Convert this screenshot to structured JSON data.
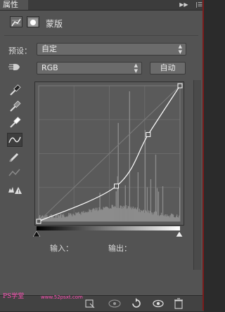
{
  "panel": {
    "tab_title": "属性",
    "header_label": "蒙版",
    "icons": [
      "curves-adjust-icon",
      "mask-icon"
    ]
  },
  "preset": {
    "label": "预设：",
    "value": "自定"
  },
  "channel": {
    "value": "RGB",
    "auto_button": "自动"
  },
  "tools": [
    "target-adjust-hand-icon",
    "black-point-eyedropper-icon",
    "gray-point-eyedropper-icon",
    "white-point-eyedropper-icon",
    "curve-edit-icon",
    "pencil-draw-icon",
    "smooth-icon",
    "clipping-warning-icon"
  ],
  "io": {
    "input_label": "输入：",
    "output_label": "输出："
  },
  "curve": {
    "points": [
      [
        0,
        0
      ],
      [
        110,
        52
      ],
      [
        155,
        128
      ],
      [
        200,
        200
      ]
    ]
  },
  "watermark": {
    "text": "PS学堂",
    "url": "www.52psxt.com"
  },
  "footer_icons": [
    "clip-to-layer-icon",
    "view-previous-icon",
    "reset-icon",
    "visibility-eye-icon",
    "delete-trash-icon"
  ]
}
